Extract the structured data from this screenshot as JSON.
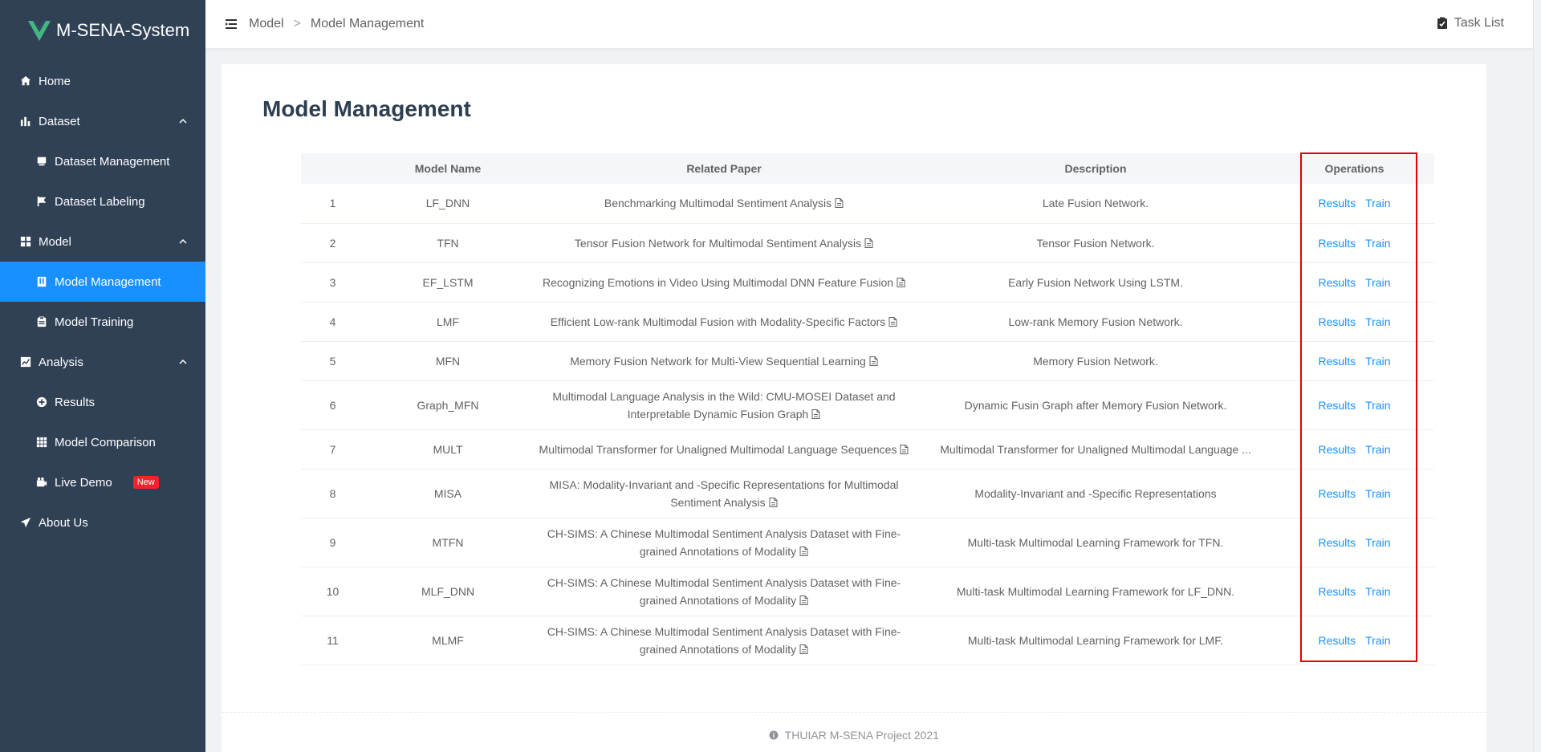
{
  "brand": {
    "title": "M-SENA-System",
    "logo_icon": "vue-logo-icon",
    "logo_color": "#41b883"
  },
  "sidebar": {
    "items": [
      {
        "label": "Home",
        "icon": "home-icon",
        "level": "top"
      },
      {
        "label": "Dataset",
        "icon": "bar-chart-icon",
        "level": "top",
        "expandable": true
      },
      {
        "label": "Dataset Management",
        "icon": "database-icon",
        "level": "sub"
      },
      {
        "label": "Dataset Labeling",
        "icon": "flag-icon",
        "level": "sub"
      },
      {
        "label": "Model",
        "icon": "grid-icon",
        "level": "top",
        "expandable": true
      },
      {
        "label": "Model Management",
        "icon": "book-icon",
        "level": "sub",
        "active": true
      },
      {
        "label": "Model Training",
        "icon": "clipboard-icon",
        "level": "sub"
      },
      {
        "label": "Analysis",
        "icon": "line-chart-icon",
        "level": "top",
        "expandable": true
      },
      {
        "label": "Results",
        "icon": "plus-circle-icon",
        "level": "sub"
      },
      {
        "label": "Model Comparison",
        "icon": "table-icon",
        "level": "sub"
      },
      {
        "label": "Live Demo",
        "icon": "camera-icon",
        "level": "sub",
        "badge": "New"
      },
      {
        "label": "About Us",
        "icon": "send-icon",
        "level": "top"
      }
    ],
    "bg_color": "#304156",
    "active_color": "#1890ff"
  },
  "header": {
    "breadcrumb": [
      "Model",
      "Model Management"
    ],
    "separator": ">",
    "task_list": "Task List"
  },
  "main": {
    "title": "Model Management",
    "table": {
      "columns": [
        "",
        "Model Name",
        "Related Paper",
        "Description",
        "Operations"
      ],
      "rows": [
        {
          "idx": "1",
          "name": "LF_DNN",
          "paper": "Benchmarking Multimodal Sentiment Analysis",
          "desc": "Late Fusion Network."
        },
        {
          "idx": "2",
          "name": "TFN",
          "paper": "Tensor Fusion Network for Multimodal Sentiment Analysis",
          "desc": "Tensor Fusion Network."
        },
        {
          "idx": "3",
          "name": "EF_LSTM",
          "paper": "Recognizing Emotions in Video Using Multimodal DNN Feature Fusion",
          "desc": "Early Fusion Network Using LSTM."
        },
        {
          "idx": "4",
          "name": "LMF",
          "paper": "Efficient Low-rank Multimodal Fusion with Modality-Specific Factors",
          "desc": "Low-rank Memory Fusion Network."
        },
        {
          "idx": "5",
          "name": "MFN",
          "paper": "Memory Fusion Network for Multi-View Sequential Learning",
          "desc": "Memory Fusion Network."
        },
        {
          "idx": "6",
          "name": "Graph_MFN",
          "paper": "Multimodal Language Analysis in the Wild: CMU-MOSEI Dataset and Interpretable Dynamic Fusion Graph",
          "desc": "Dynamic Fusin Graph after Memory Fusion Network."
        },
        {
          "idx": "7",
          "name": "MULT",
          "paper": "Multimodal Transformer for Unaligned Multimodal Language Sequences",
          "desc": "Multimodal Transformer for Unaligned Multimodal Language ..."
        },
        {
          "idx": "8",
          "name": "MISA",
          "paper": "MISA: Modality-Invariant and -Specific Representations for Multimodal Sentiment Analysis",
          "desc": "Modality-Invariant and -Specific Representations"
        },
        {
          "idx": "9",
          "name": "MTFN",
          "paper": "CH-SIMS: A Chinese Multimodal Sentiment Analysis Dataset with Fine-grained Annotations of Modality",
          "desc": "Multi-task Multimodal Learning Framework for TFN."
        },
        {
          "idx": "10",
          "name": "MLF_DNN",
          "paper": "CH-SIMS: A Chinese Multimodal Sentiment Analysis Dataset with Fine-grained Annotations of Modality",
          "desc": "Multi-task Multimodal Learning Framework for LF_DNN."
        },
        {
          "idx": "11",
          "name": "MLMF",
          "paper": "CH-SIMS: A Chinese Multimodal Sentiment Analysis Dataset with Fine-grained Annotations of Modality",
          "desc": "Multi-task Multimodal Learning Framework for LMF."
        }
      ],
      "ops": {
        "results": "Results",
        "train": "Train"
      },
      "link_color": "#1890ff",
      "highlight_color": "#e80000"
    }
  },
  "footer": {
    "text": "THUIAR M-SENA Project 2021",
    "icon": "info-circle-icon"
  }
}
